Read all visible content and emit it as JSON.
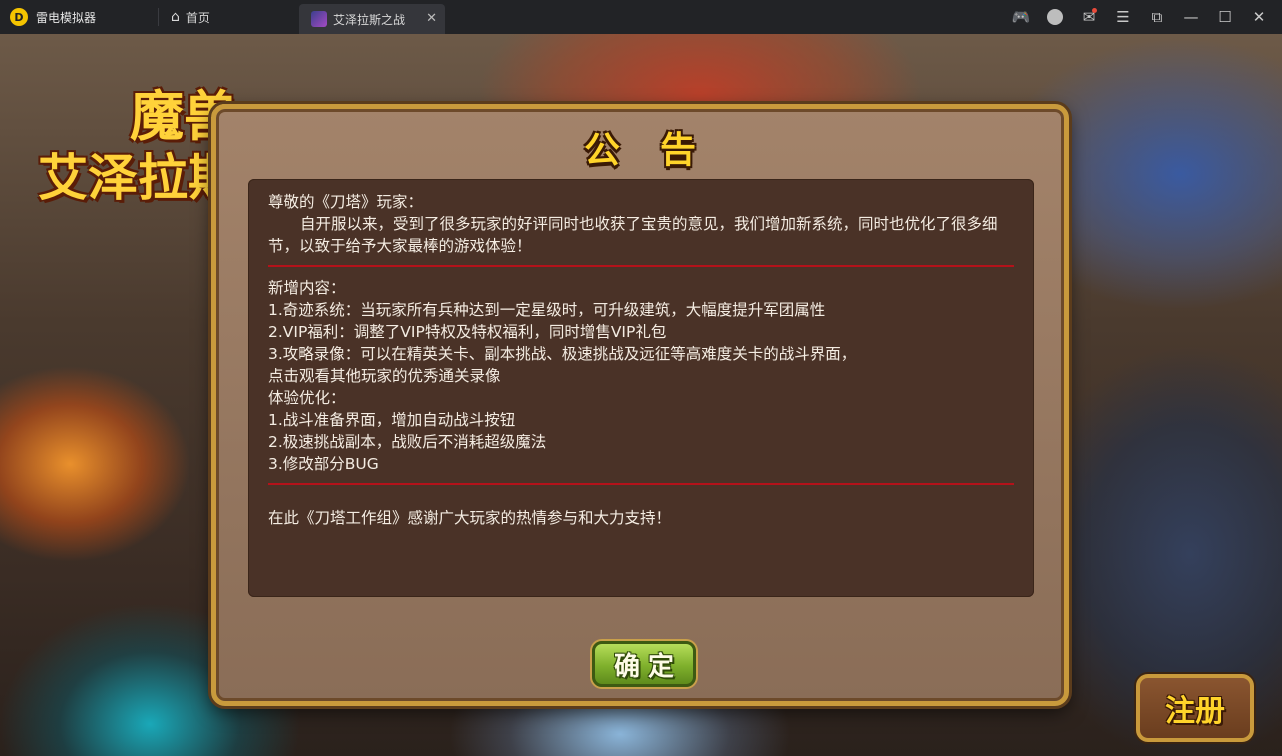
{
  "app": {
    "name": "雷电模拟器",
    "logo_glyph": "D"
  },
  "tabs": [
    {
      "label": "首页",
      "icon": "home-icon"
    },
    {
      "label": "艾泽拉斯之战",
      "icon": "game-thumbnail-icon",
      "active": true
    }
  ],
  "window_controls": [
    {
      "name": "gamepad-icon",
      "glyph": "🎮"
    },
    {
      "name": "avatar-icon",
      "glyph": ""
    },
    {
      "name": "mail-icon",
      "glyph": "✉",
      "has_notification": true
    },
    {
      "name": "menu-icon",
      "glyph": "☰"
    },
    {
      "name": "pin-icon",
      "glyph": "⧉"
    },
    {
      "name": "minimize-icon",
      "glyph": "—"
    },
    {
      "name": "maximize-icon",
      "glyph": "☐"
    },
    {
      "name": "close-icon",
      "glyph": "✕"
    }
  ],
  "game": {
    "logo_top": "魔兽",
    "logo_bottom": "艾泽拉斯",
    "register_label": "注册"
  },
  "announcement": {
    "title": "公告",
    "greeting": "尊敬的《刀塔》玩家：",
    "intro": "自开服以来，受到了很多玩家的好评同时也收获了宝贵的意见，我们增加新系统，同时也优化了很多细节，以致于给予大家最棒的游戏体验！",
    "new_heading": "新增内容：",
    "new_items": [
      "1.奇迹系统：当玩家所有兵种达到一定星级时，可升级建筑，大幅度提升军团属性",
      "2.VIP福利：调整了VIP特权及特权福利，同时增售VIP礼包",
      "3.攻略录像：可以在精英关卡、副本挑战、极速挑战及远征等高难度关卡的战斗界面，",
      "点击观看其他玩家的优秀通关录像"
    ],
    "opt_heading": "体验优化：",
    "opt_items": [
      "1.战斗准备界面，增加自动战斗按钮",
      "2.极速挑战副本，战败后不消耗超级魔法",
      "3.修改部分BUG"
    ],
    "thanks": "在此《刀塔工作组》感谢广大玩家的热情参与和大力支持！",
    "confirm_label": "确定"
  },
  "colors": {
    "title_gold": "#ffd42a",
    "divider_red": "#b4121a",
    "confirm_green": "#7fb02c"
  }
}
